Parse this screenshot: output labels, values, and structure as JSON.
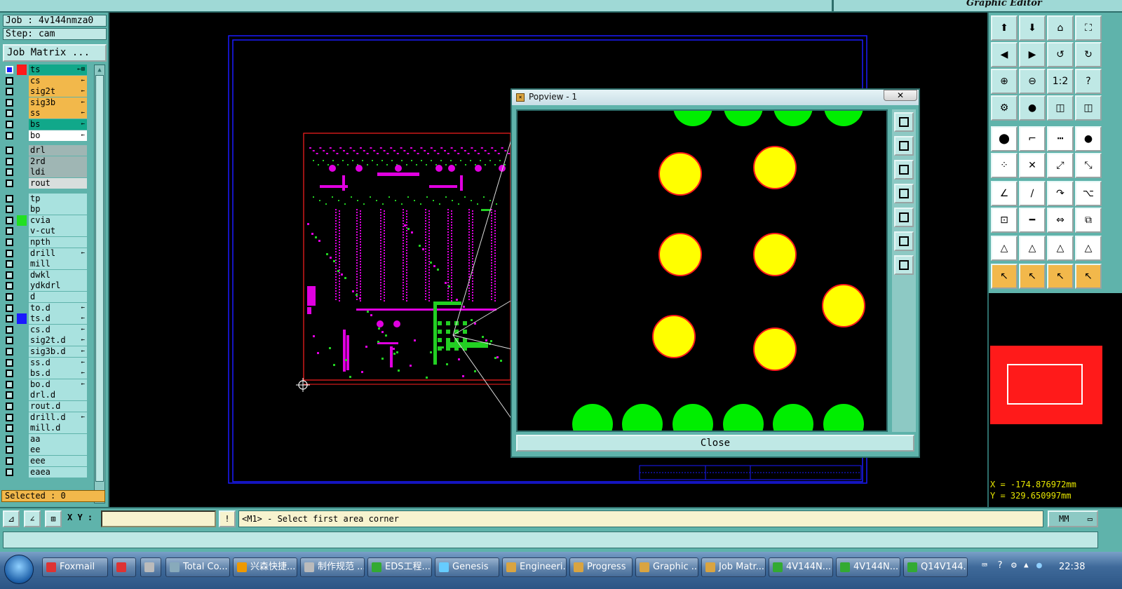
{
  "header": {
    "app_label": "Graphic Editor"
  },
  "job_info": {
    "job": "Job : 4v144nmza0",
    "step": "Step: cam",
    "job_matrix_button": "Job Matrix ..."
  },
  "layers": [
    {
      "name": "ts",
      "color": "#11a88a",
      "swatch": "#ff1a1a",
      "active": true,
      "mark": "←⊞"
    },
    {
      "name": "cs",
      "color": "#f2b84b",
      "swatch": "",
      "mark": "←"
    },
    {
      "name": "sig2t",
      "color": "#f2b84b",
      "swatch": "",
      "mark": "←"
    },
    {
      "name": "sig3b",
      "color": "#f2b84b",
      "swatch": "",
      "mark": "←"
    },
    {
      "name": "ss",
      "color": "#f2b84b",
      "swatch": "",
      "mark": "←"
    },
    {
      "name": "bs",
      "color": "#11a88a",
      "swatch": "",
      "mark": "←"
    },
    {
      "name": "bo",
      "color": "#ffffff",
      "swatch": "",
      "mark": "←"
    },
    {
      "name": "drl",
      "color": "#9fb6b4",
      "swatch": "",
      "mark": ""
    },
    {
      "name": "2rd",
      "color": "#9fb6b4",
      "swatch": "",
      "mark": ""
    },
    {
      "name": "ldi",
      "color": "#9fb6b4",
      "swatch": "",
      "mark": ""
    },
    {
      "name": "rout",
      "color": "#d8dedd",
      "swatch": "",
      "mark": ""
    },
    {
      "name": "tp",
      "color": "#a9e2df",
      "swatch": "",
      "mark": ""
    },
    {
      "name": "bp",
      "color": "#a9e2df",
      "swatch": "",
      "mark": ""
    },
    {
      "name": "cvia",
      "color": "#a9e2df",
      "swatch": "#22e022",
      "mark": ""
    },
    {
      "name": "v-cut",
      "color": "#a9e2df",
      "swatch": "",
      "mark": ""
    },
    {
      "name": "npth",
      "color": "#a9e2df",
      "swatch": "",
      "mark": ""
    },
    {
      "name": "drill",
      "color": "#a9e2df",
      "swatch": "",
      "mark": "←"
    },
    {
      "name": "mill",
      "color": "#a9e2df",
      "swatch": "",
      "mark": ""
    },
    {
      "name": "dwkl",
      "color": "#a9e2df",
      "swatch": "",
      "mark": ""
    },
    {
      "name": "ydkdrl",
      "color": "#a9e2df",
      "swatch": "",
      "mark": ""
    },
    {
      "name": "d",
      "color": "#a9e2df",
      "swatch": "",
      "mark": ""
    },
    {
      "name": "to.d",
      "color": "#a9e2df",
      "swatch": "",
      "mark": "←"
    },
    {
      "name": "ts.d",
      "color": "#a9e2df",
      "swatch": "#1a1aff",
      "mark": "←"
    },
    {
      "name": "cs.d",
      "color": "#a9e2df",
      "swatch": "",
      "mark": "←"
    },
    {
      "name": "sig2t.d",
      "color": "#a9e2df",
      "swatch": "",
      "mark": "←"
    },
    {
      "name": "sig3b.d",
      "color": "#a9e2df",
      "swatch": "",
      "mark": "←"
    },
    {
      "name": "ss.d",
      "color": "#a9e2df",
      "swatch": "",
      "mark": "←"
    },
    {
      "name": "bs.d",
      "color": "#a9e2df",
      "swatch": "",
      "mark": "←"
    },
    {
      "name": "bo.d",
      "color": "#a9e2df",
      "swatch": "",
      "mark": "←"
    },
    {
      "name": "drl.d",
      "color": "#a9e2df",
      "swatch": "",
      "mark": ""
    },
    {
      "name": "rout.d",
      "color": "#a9e2df",
      "swatch": "",
      "mark": ""
    },
    {
      "name": "drill.d",
      "color": "#a9e2df",
      "swatch": "",
      "mark": "←"
    },
    {
      "name": "mill.d",
      "color": "#a9e2df",
      "swatch": "",
      "mark": ""
    },
    {
      "name": "aa",
      "color": "#a9e2df",
      "swatch": "",
      "mark": ""
    },
    {
      "name": "ee",
      "color": "#a9e2df",
      "swatch": "",
      "mark": ""
    },
    {
      "name": "eee",
      "color": "#a9e2df",
      "swatch": "",
      "mark": ""
    },
    {
      "name": "eaea",
      "color": "#a9e2df",
      "swatch": "",
      "mark": ""
    }
  ],
  "selected": "Selected : 0",
  "popview": {
    "title": "Popview - 1",
    "close_x": "✕",
    "close_button": "Close"
  },
  "command": {
    "xy_label": "X Y :",
    "xy_value": "",
    "message": "<M1> - Select first area corner",
    "unit": "MM"
  },
  "coordinates": {
    "x": "X = -174.876972mm",
    "y": "Y = 329.650997mm"
  },
  "taskbar": {
    "items": [
      {
        "label": "Foxmail",
        "icon_color": "#d33"
      },
      {
        "label": "",
        "icon_color": "#d33"
      },
      {
        "label": "",
        "icon_color": "#bbb"
      },
      {
        "label": "Total Co...",
        "icon_color": "#8ab"
      },
      {
        "label": "兴森快捷...",
        "icon_color": "#e90"
      },
      {
        "label": "制作规范 ...",
        "icon_color": "#bbb"
      },
      {
        "label": "EDS工程...",
        "icon_color": "#3a3"
      },
      {
        "label": "Genesis",
        "icon_color": "#6cf"
      },
      {
        "label": "Engineeri...",
        "icon_color": "#d9a441"
      },
      {
        "label": "Progress",
        "icon_color": "#d9a441"
      },
      {
        "label": "Graphic ...",
        "icon_color": "#d9a441"
      },
      {
        "label": "Job Matr...",
        "icon_color": "#d9a441"
      },
      {
        "label": "4V144N...",
        "icon_color": "#3a3"
      },
      {
        "label": "4V144N...",
        "icon_color": "#3a3"
      },
      {
        "label": "Q14V144...",
        "icon_color": "#3a3"
      }
    ],
    "clock": "22:38"
  },
  "colors": {
    "panel": "#5fb3ab",
    "pad_yellow": "#ffff00",
    "pad_green": "#00ee00",
    "pad_outline": "#ff1a1a",
    "board_magenta": "#e000e0",
    "board_green": "#22d022",
    "frame_blue": "#1a1aff"
  }
}
